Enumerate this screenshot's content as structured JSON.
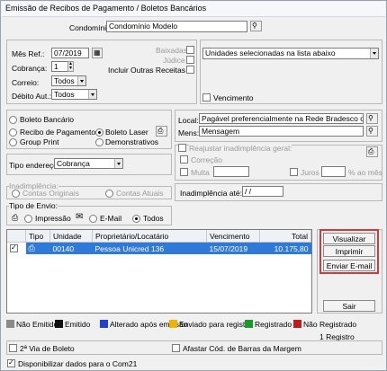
{
  "window": {
    "title": "Emissão de Recibos de Pagamento / Boletos Bancários"
  },
  "condominio": {
    "label": "Condomínio:",
    "value": "Condomínio Modelo"
  },
  "left_form": {
    "mes_ref_label": "Mês Ref.:",
    "mes_ref_value": "07/2019",
    "cobranca_label": "Cobrança:",
    "cobranca_value": "1",
    "correio_label": "Correio:",
    "correio_value": "Todos",
    "debito_label": "Débito Aut.:",
    "debito_value": "Todos",
    "baixadas_label": "Baixadas",
    "judice_label": "Júdice",
    "incluir_outras_label": "Incluir Outras Receitas"
  },
  "unidades": {
    "value": "Unidades selecionadas na lista abaixo",
    "vencimento_label": "Vencimento"
  },
  "doc_type": {
    "boleto_bancario": "Boleto Bancário",
    "recibo_pagamento": "Recibo de Pagamento",
    "boleto_laser": "Boleto Laser",
    "group_print": "Group Print",
    "demonstrativos": "Demonstrativos"
  },
  "local_mens": {
    "local_label": "Local:",
    "local_value": "Pagável preferencialmente na Rede Bradesco ou",
    "mens_label": "Mens:",
    "mens_value": "Mensagem"
  },
  "reajustar": {
    "title": "Reajustar inadimplência geral:",
    "correcao": "Correção",
    "multa": "Multa",
    "juros": "Juros",
    "ao_mes": "% ao mês"
  },
  "endereco": {
    "label": "Tipo endereço:",
    "value": "Cobrança"
  },
  "inadimplencia": {
    "title": "Inadimplência:",
    "contas_originais": "Contas Originais",
    "contas_atuais": "Contas Atuais",
    "ate_label": "Inadimplência até:",
    "ate_value": "/ /"
  },
  "envio": {
    "title": "Tipo de Envio:",
    "impressao": "Impressão",
    "email": "E-Mail",
    "todos": "Todos"
  },
  "table": {
    "columns": [
      "Tipo",
      "Unidade",
      "Proprietário/Locatário",
      "Vencimento",
      "Total"
    ],
    "rows": [
      {
        "unidade": "00140",
        "proprietario": "Pessoa Unicred 136",
        "vencimento": "15/07/2019",
        "total": "10.175,80"
      }
    ]
  },
  "actions": {
    "visualizar": "Visualizar",
    "imprimir": "Imprimir",
    "enviar_email": "Enviar E-mail",
    "sair": "Sair"
  },
  "legend": [
    {
      "label": "Não Emitido",
      "color": "#8a8a8a"
    },
    {
      "label": "Emitido",
      "color": "#111111"
    },
    {
      "label": "Alterado após emissão",
      "color": "#1f3fd6"
    },
    {
      "label": "Enviado para registro",
      "color": "#f0b400"
    },
    {
      "label": "Registrado",
      "color": "#1a9a2a"
    },
    {
      "label": "Não Registrado",
      "color": "#c21b1b"
    }
  ],
  "registro_count": "1 Registro",
  "footer": {
    "segunda_via": "2ª Via de Boleto",
    "afastar": "Afastar Cód. de Barras da Margem",
    "disponibilizar": "Disponibilizar dados para o Com21"
  }
}
